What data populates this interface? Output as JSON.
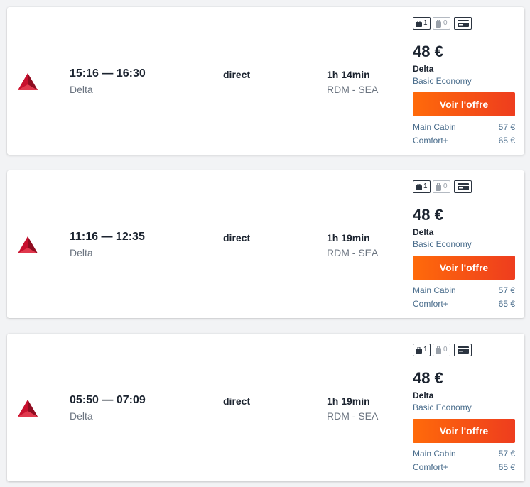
{
  "results": [
    {
      "times": "15:16 — 16:30",
      "airline": "Delta",
      "stops": "direct",
      "duration": "1h 14min",
      "route": "RDM - SEA",
      "bags": {
        "cabin": "1",
        "checked": "0"
      },
      "price": "48 €",
      "price_airline": "Delta",
      "fare_class": "Basic Economy",
      "cta": "Voir l'offre",
      "alternatives": [
        {
          "name": "Main Cabin",
          "price": "57 €"
        },
        {
          "name": "Comfort+",
          "price": "65 €"
        }
      ]
    },
    {
      "times": "11:16 — 12:35",
      "airline": "Delta",
      "stops": "direct",
      "duration": "1h 19min",
      "route": "RDM - SEA",
      "bags": {
        "cabin": "1",
        "checked": "0"
      },
      "price": "48 €",
      "price_airline": "Delta",
      "fare_class": "Basic Economy",
      "cta": "Voir l'offre",
      "alternatives": [
        {
          "name": "Main Cabin",
          "price": "57 €"
        },
        {
          "name": "Comfort+",
          "price": "65 €"
        }
      ]
    },
    {
      "times": "05:50 — 07:09",
      "airline": "Delta",
      "stops": "direct",
      "duration": "1h 19min",
      "route": "RDM - SEA",
      "bags": {
        "cabin": "1",
        "checked": "0"
      },
      "price": "48 €",
      "price_airline": "Delta",
      "fare_class": "Basic Economy",
      "cta": "Voir l'offre",
      "alternatives": [
        {
          "name": "Main Cabin",
          "price": "57 €"
        },
        {
          "name": "Comfort+",
          "price": "65 €"
        }
      ]
    }
  ],
  "icons": {
    "logo": "delta-logo-icon",
    "cabin_bag": "cabin-bag-icon",
    "checked_bag": "checked-bag-icon",
    "fare_info": "credit-card-icon"
  },
  "colors": {
    "accent_start": "#ff6a0a",
    "accent_end": "#ee3d1e",
    "delta_red": "#c8102e",
    "link_blue": "#4a6d8c"
  }
}
